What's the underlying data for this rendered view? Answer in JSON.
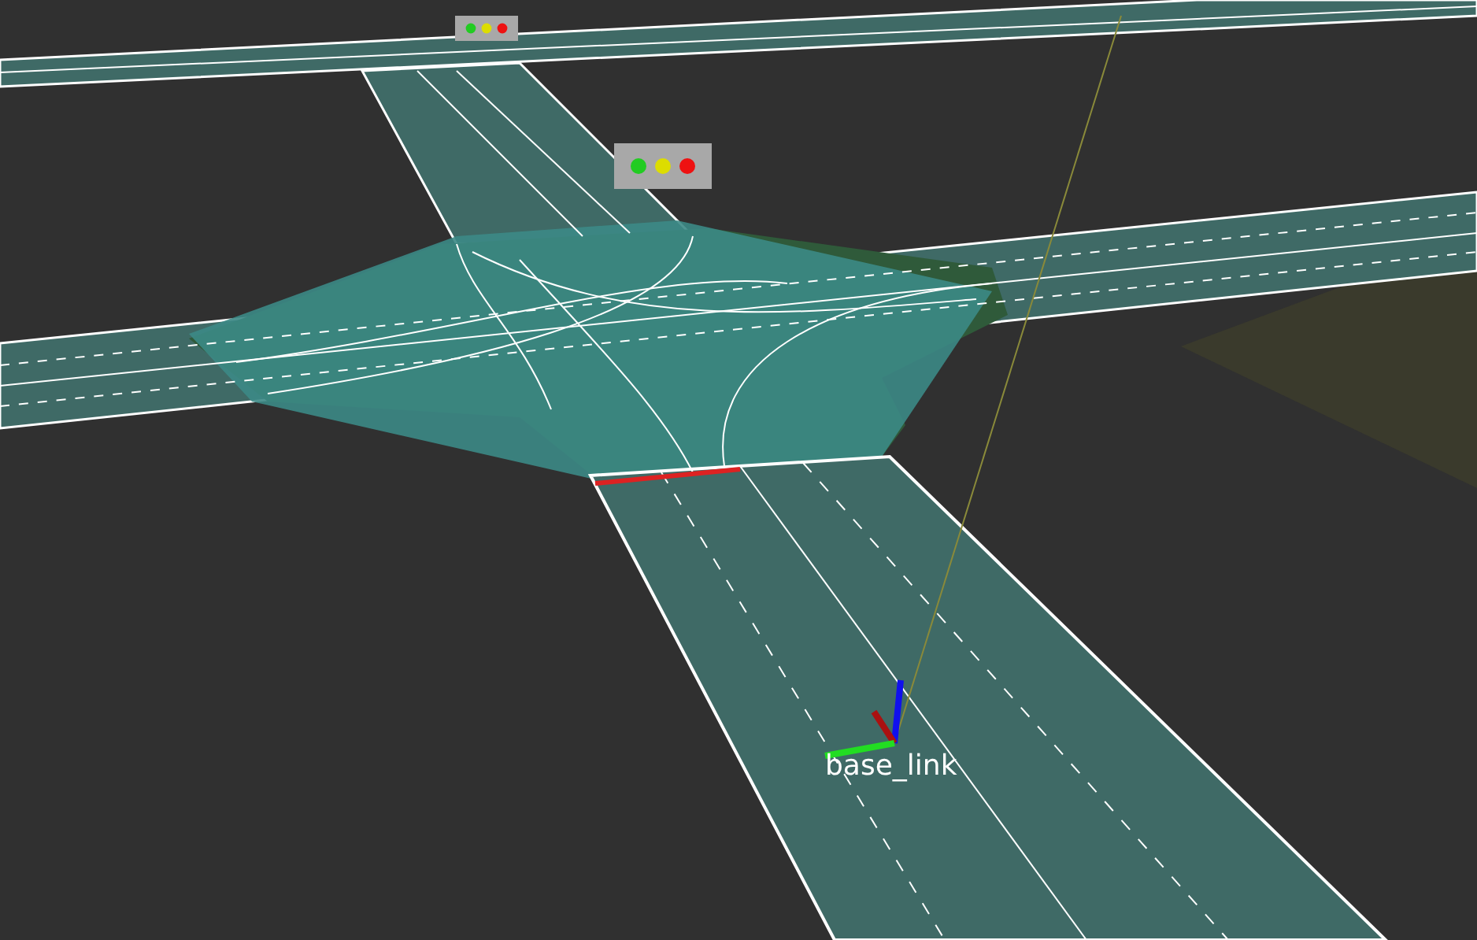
{
  "viewport": {
    "traffic_lights": [
      {
        "lamps": [
          {
            "color": "#22cc22"
          },
          {
            "color": "#dddd00"
          },
          {
            "color": "#ee1111"
          }
        ]
      },
      {
        "lamps": [
          {
            "color": "#22cc22"
          },
          {
            "color": "#dddd00"
          },
          {
            "color": "#ee1111"
          }
        ]
      }
    ],
    "frame_label": "base_link"
  }
}
